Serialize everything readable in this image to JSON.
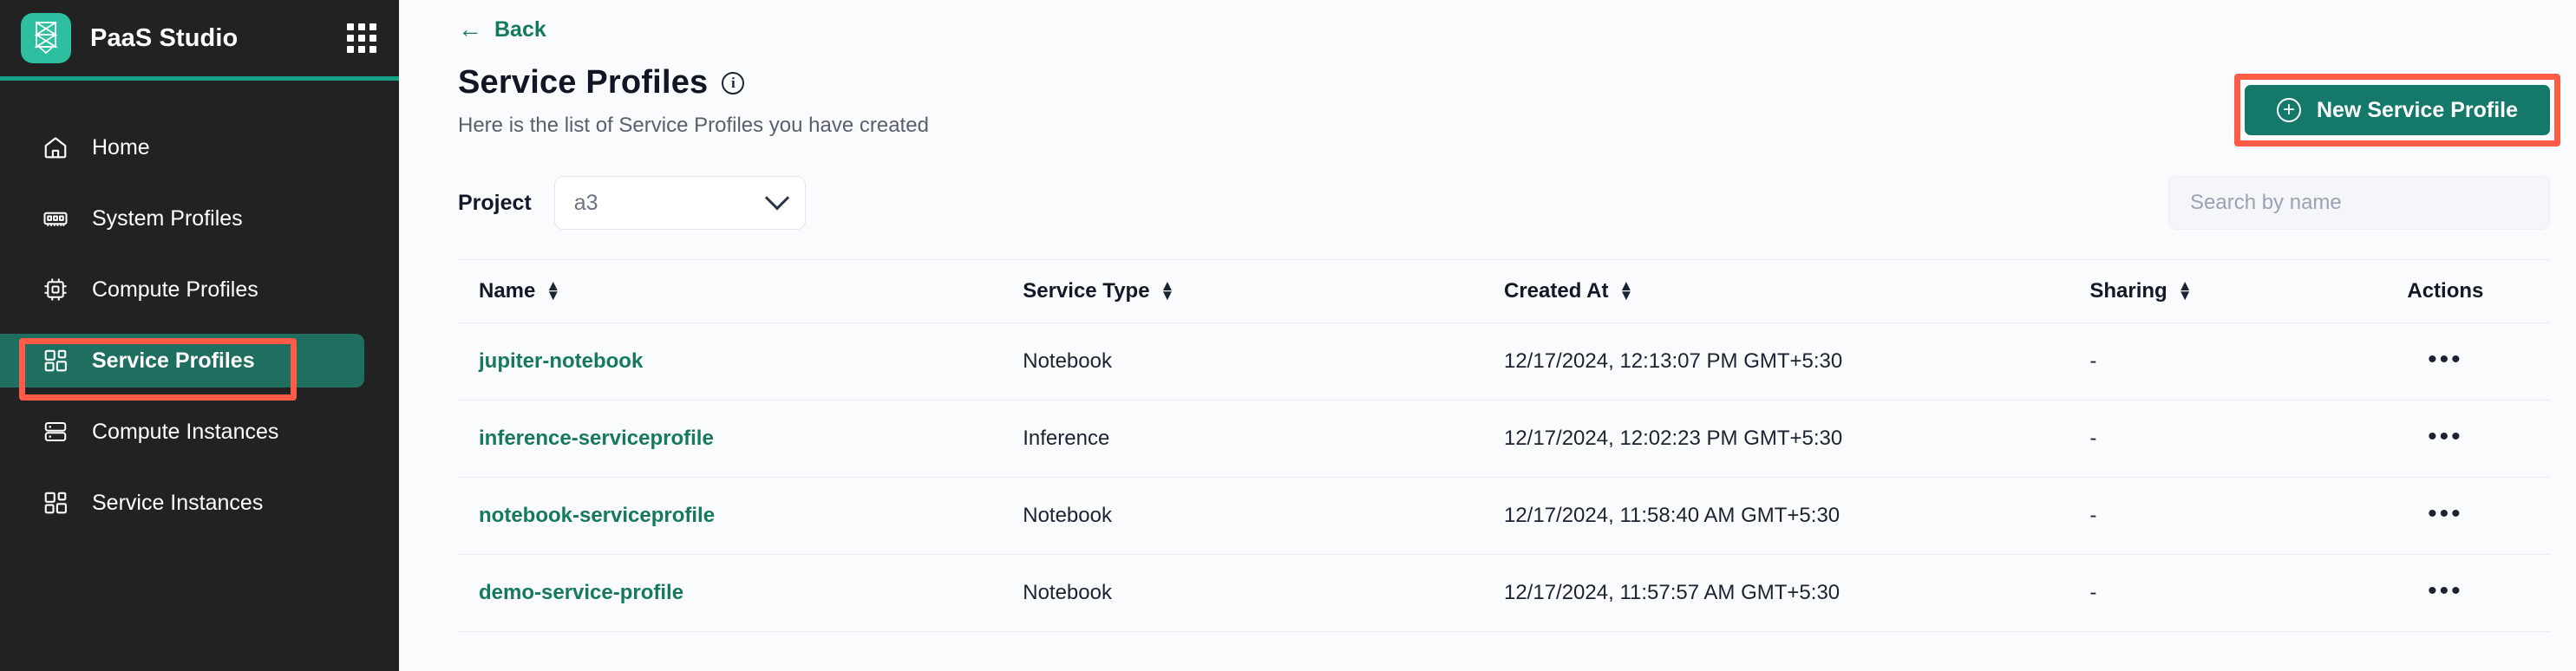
{
  "brand": {
    "name": "PaaS Studio",
    "logo_icon": "mesh-logo-icon",
    "apps_grid_icon": "apps-grid-icon",
    "accent_color": "#16a085",
    "sidebar_bg": "#222222"
  },
  "sidebar": {
    "items": [
      {
        "label": "Home",
        "icon": "home-icon",
        "active": false
      },
      {
        "label": "System Profiles",
        "icon": "memory-chip-icon",
        "active": false
      },
      {
        "label": "Compute Profiles",
        "icon": "cpu-icon",
        "active": false
      },
      {
        "label": "Service Profiles",
        "icon": "blocks-icon",
        "active": true
      },
      {
        "label": "Compute Instances",
        "icon": "server-icon",
        "active": false
      },
      {
        "label": "Service Instances",
        "icon": "blocks-icon",
        "active": false
      }
    ]
  },
  "header": {
    "back_label": "Back",
    "back_icon": "arrow-left-icon",
    "title": "Service Profiles",
    "info_icon": "info-icon",
    "subtitle": "Here is the list of Service Profiles you have created",
    "primary_button": {
      "label": "New Service Profile",
      "icon": "plus-circle-icon",
      "color": "#14796a",
      "highlight_color": "#ff5b47"
    }
  },
  "filters": {
    "project_label": "Project",
    "project_value": "a3",
    "project_chevron_icon": "chevron-down-icon",
    "search_placeholder": "Search by name",
    "search_value": ""
  },
  "table": {
    "columns": [
      {
        "label": "Name",
        "sortable": true,
        "sort_icon": "sort-arrows-icon"
      },
      {
        "label": "Service Type",
        "sortable": true,
        "sort_icon": "sort-arrows-icon"
      },
      {
        "label": "Created At",
        "sortable": true,
        "sort_icon": "sort-arrows-icon"
      },
      {
        "label": "Sharing",
        "sortable": true,
        "sort_icon": "sort-arrows-icon"
      },
      {
        "label": "Actions",
        "sortable": false,
        "sort_icon": ""
      }
    ],
    "rows": [
      {
        "name": "jupiter-notebook",
        "service_type": "Notebook",
        "created_at": "12/17/2024, 12:13:07 PM GMT+5:30",
        "sharing": "-",
        "actions_icon": "ellipsis-icon"
      },
      {
        "name": "inference-serviceprofile",
        "service_type": "Inference",
        "created_at": "12/17/2024, 12:02:23 PM GMT+5:30",
        "sharing": "-",
        "actions_icon": "ellipsis-icon"
      },
      {
        "name": "notebook-serviceprofile",
        "service_type": "Notebook",
        "created_at": "12/17/2024, 11:58:40 AM GMT+5:30",
        "sharing": "-",
        "actions_icon": "ellipsis-icon"
      },
      {
        "name": "demo-service-profile",
        "service_type": "Notebook",
        "created_at": "12/17/2024, 11:57:57 AM GMT+5:30",
        "sharing": "-",
        "actions_icon": "ellipsis-icon"
      }
    ]
  }
}
